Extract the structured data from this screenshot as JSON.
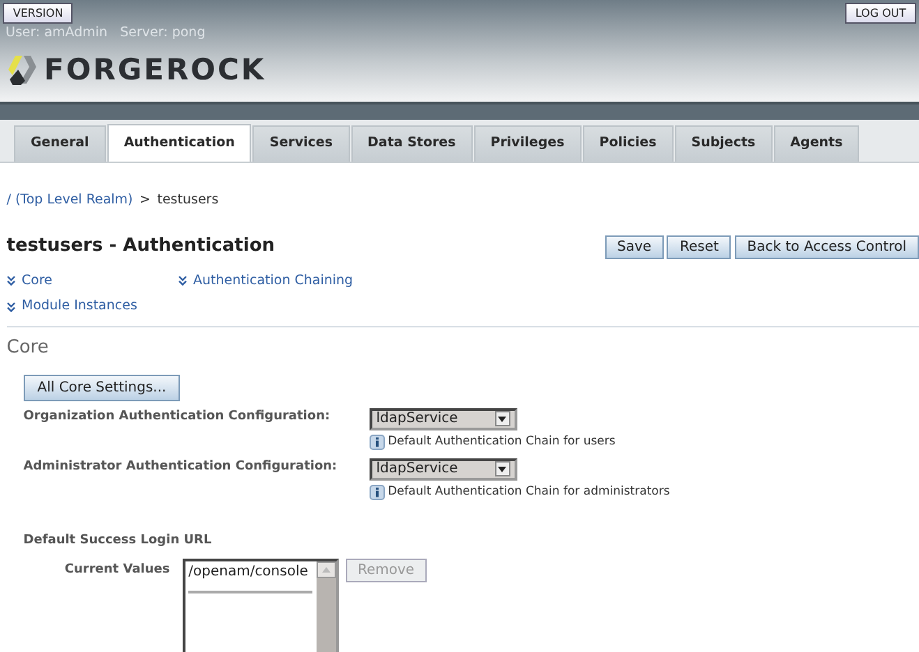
{
  "header": {
    "version_button": "VERSION",
    "logout_button": "LOG OUT",
    "user_info": "User: amAdmin   Server: pong",
    "logo_text": "FORGEROCK"
  },
  "tabs": [
    {
      "label": "General",
      "selected": false
    },
    {
      "label": "Authentication",
      "selected": true
    },
    {
      "label": "Services",
      "selected": false
    },
    {
      "label": "Data Stores",
      "selected": false
    },
    {
      "label": "Privileges",
      "selected": false
    },
    {
      "label": "Policies",
      "selected": false
    },
    {
      "label": "Subjects",
      "selected": false
    },
    {
      "label": "Agents",
      "selected": false
    }
  ],
  "breadcrumb": {
    "link": "/ (Top Level Realm)",
    "separator": ">",
    "current": "testusers"
  },
  "page_title": "testusers - Authentication",
  "actions": [
    {
      "label": "Save"
    },
    {
      "label": "Reset"
    },
    {
      "label": "Back to Access Control"
    }
  ],
  "jump_links": [
    {
      "label": "Core"
    },
    {
      "label": "Authentication Chaining"
    },
    {
      "label": "Module Instances"
    }
  ],
  "section_title": "Core",
  "all_settings_button": "All Core Settings...",
  "settings": [
    {
      "label": "Organization Authentication Configuration:",
      "value": "ldapService",
      "help": "Default Authentication Chain for users"
    },
    {
      "label": "Administrator Authentication Configuration:",
      "value": "ldapService",
      "help": "Default Authentication Chain for administrators"
    }
  ],
  "success_url": {
    "title": "Default Success Login URL",
    "label": "Current Values",
    "values": [
      "/openam/console"
    ],
    "remove_button": {
      "label": "Remove",
      "disabled": true
    }
  }
}
